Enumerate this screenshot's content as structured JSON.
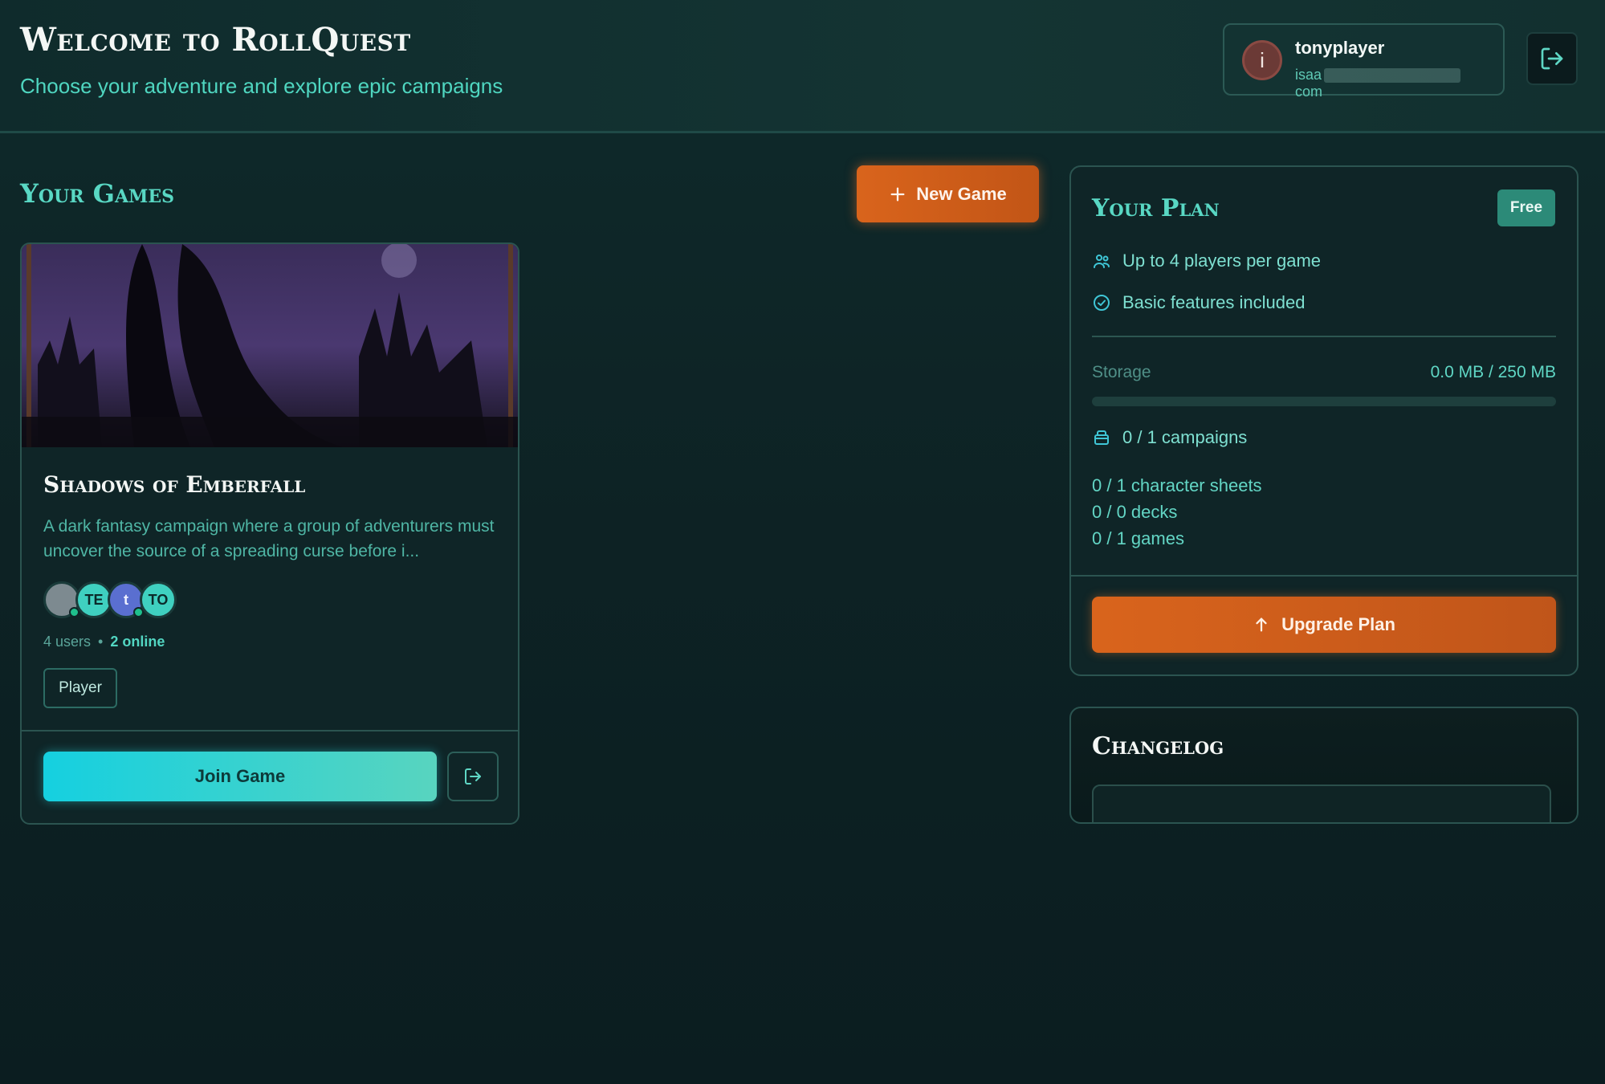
{
  "header": {
    "title": "Welcome to RollQuest",
    "subtitle": "Choose your adventure and explore epic campaigns"
  },
  "user": {
    "avatar_initial": "i",
    "name": "tonyplayer",
    "email_visible_start": "isaa",
    "email_visible_end": "com"
  },
  "games_section": {
    "title": "Your Games",
    "new_game_label": "New Game"
  },
  "game_card": {
    "title": "Shadows of Emberfall",
    "description": "A dark fantasy campaign where a group of adventurers must uncover the source of a spreading curse before i...",
    "avatars": [
      {
        "label": "",
        "color": "#7d8a90",
        "online": true
      },
      {
        "label": "TE",
        "color": "#3fd0c0",
        "online": false
      },
      {
        "label": "t",
        "color": "#5a6fd0",
        "online": true
      },
      {
        "label": "TO",
        "color": "#3fd0c0",
        "online": false
      }
    ],
    "users_count": "4 users",
    "separator": "•",
    "online_count": "2 online",
    "role": "Player",
    "join_label": "Join Game"
  },
  "plan": {
    "title": "Your Plan",
    "badge": "Free",
    "features": [
      {
        "icon": "users-icon",
        "text": "Up to 4 players per game"
      },
      {
        "icon": "check-circle-icon",
        "text": "Basic features included"
      }
    ],
    "storage_label": "Storage",
    "storage_value": "0.0 MB / 250 MB",
    "storage_fraction": 0.0,
    "campaigns": "0 / 1 campaigns",
    "character_sheets": "0 / 1 character sheets",
    "decks": "0 / 0 decks",
    "games": "0 / 1 games",
    "upgrade_label": "Upgrade Plan"
  },
  "changelog": {
    "title": "Changelog"
  },
  "colors": {
    "accent_teal": "#59d8c4",
    "accent_orange": "#d9641c",
    "join_cyan": "#15d0e0"
  }
}
